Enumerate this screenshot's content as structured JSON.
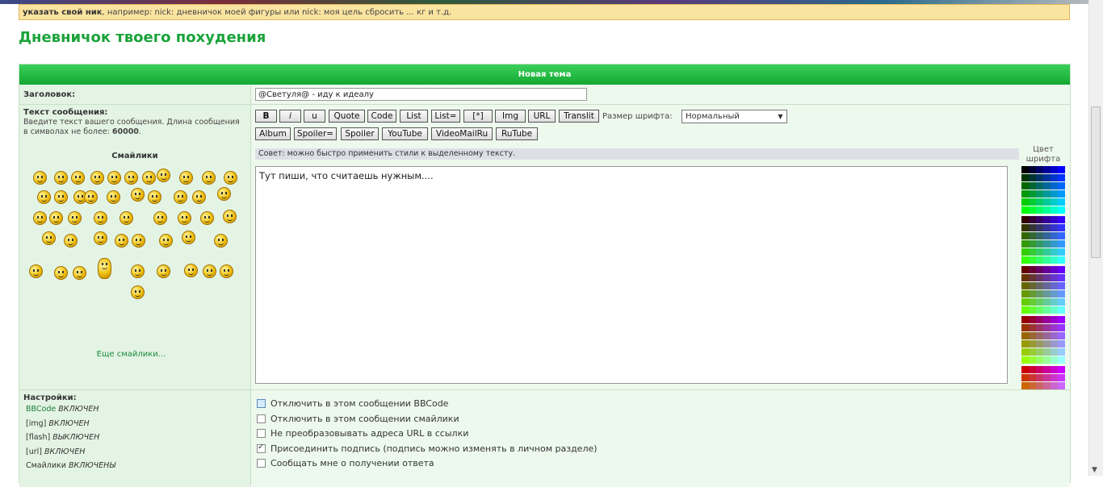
{
  "notice": {
    "bold": "указать свой ник",
    "text": ", например: nick: дневничок моей фигуры или nick: моя цель сбросить ... кг и т.д."
  },
  "page_title": "Дневничок твоего похудения",
  "form": {
    "header": "Новая тема",
    "subject_label": "Заголовок:",
    "subject_value": "@Светуля@ - иду к идеалу",
    "message_label": "Текст сообщения:",
    "message_desc": "Введите текст вашего сообщения. Длина сообщения в символах не более: ",
    "message_max": "60000",
    "smileys_title": "Смайлики",
    "more_smileys": "Еще смайлики...",
    "toolbar_row1": [
      "B",
      "i",
      "u",
      "Quote",
      "Code",
      "List",
      "List=",
      "[*]",
      "Img",
      "URL",
      "Translit"
    ],
    "toolbar_row2": [
      "Album",
      "Spoiler=",
      "Spoiler",
      "YouTube",
      "VideoMailRu",
      "RuTube"
    ],
    "font_size_label": "Размер шрифта:",
    "font_size_value": "Нормальный",
    "tip": "Совет: можно быстро применить стили к выделенному тексту.",
    "message_text": "Тут пиши, что считаешь нужным....",
    "font_color_label": "Цвет шрифта",
    "settings_label": "Настройки:",
    "settings": [
      {
        "name": "BBCode",
        "state": "ВКЛЮЧЕН"
      },
      {
        "name": "[img]",
        "state": "ВКЛЮЧЕН"
      },
      {
        "name": "[flash]",
        "state": "ВЫКЛЮЧЕН"
      },
      {
        "name": "[url]",
        "state": "ВКЛЮЧЕН"
      },
      {
        "name": "Смайлики",
        "state": "ВКЛЮЧЕНЫ"
      }
    ],
    "options": [
      {
        "label": "Отключить в этом сообщении BBCode",
        "checked": false
      },
      {
        "label": "Отключить в этом сообщении смайлики",
        "checked": false
      },
      {
        "label": "Не преобразовывать адреса URL в ссылки",
        "checked": false
      },
      {
        "label": "Присоединить подпись (подпись можно изменять в личном разделе)",
        "checked": true
      },
      {
        "label": "Сообщать мне о получении ответа",
        "checked": false
      }
    ]
  }
}
